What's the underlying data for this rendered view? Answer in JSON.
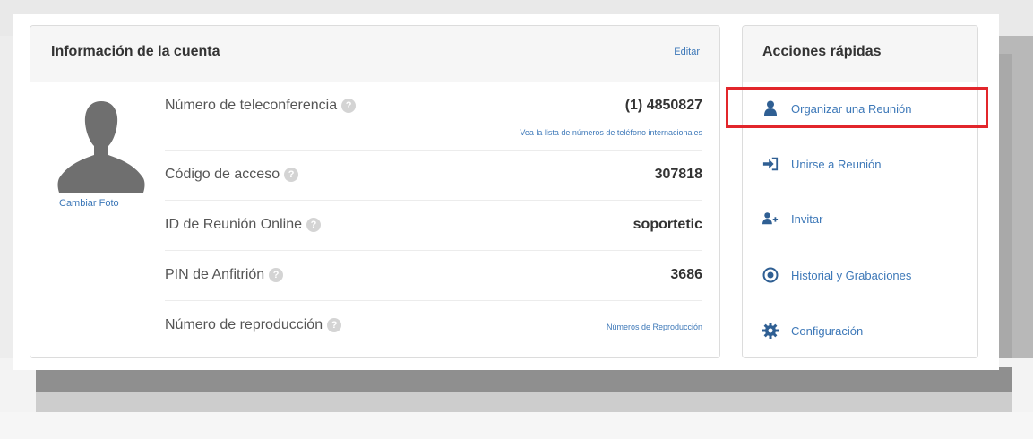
{
  "account": {
    "title": "Información de la cuenta",
    "edit_label": "Editar",
    "change_photo_label": "Cambiar Foto",
    "rows": [
      {
        "label": "Número de teleconferencia",
        "value": "(1) 4850827",
        "link": "Vea la lista de números de teléfono internacionales"
      },
      {
        "label": "Código de acceso",
        "value": "307818"
      },
      {
        "label": "ID de Reunión Online",
        "value": "soportetic"
      },
      {
        "label": "PIN de Anfitrión",
        "value": "3686"
      },
      {
        "label": "Número de reproducción",
        "link": "Números de Reproducción"
      }
    ],
    "help_glyph": "?"
  },
  "quick_actions": {
    "title": "Acciones rápidas",
    "items": [
      {
        "label": "Organizar una Reunión",
        "icon": "user-icon"
      },
      {
        "label": "Unirse a Reunión",
        "icon": "sign-in-icon"
      },
      {
        "label": "Invitar",
        "icon": "add-user-icon"
      },
      {
        "label": "Historial y Grabaciones",
        "icon": "record-icon"
      },
      {
        "label": "Configuración",
        "icon": "gear-icon"
      }
    ]
  },
  "colors": {
    "link": "#3d78b8",
    "icon": "#2f5f93",
    "highlight": "#e2262b"
  }
}
